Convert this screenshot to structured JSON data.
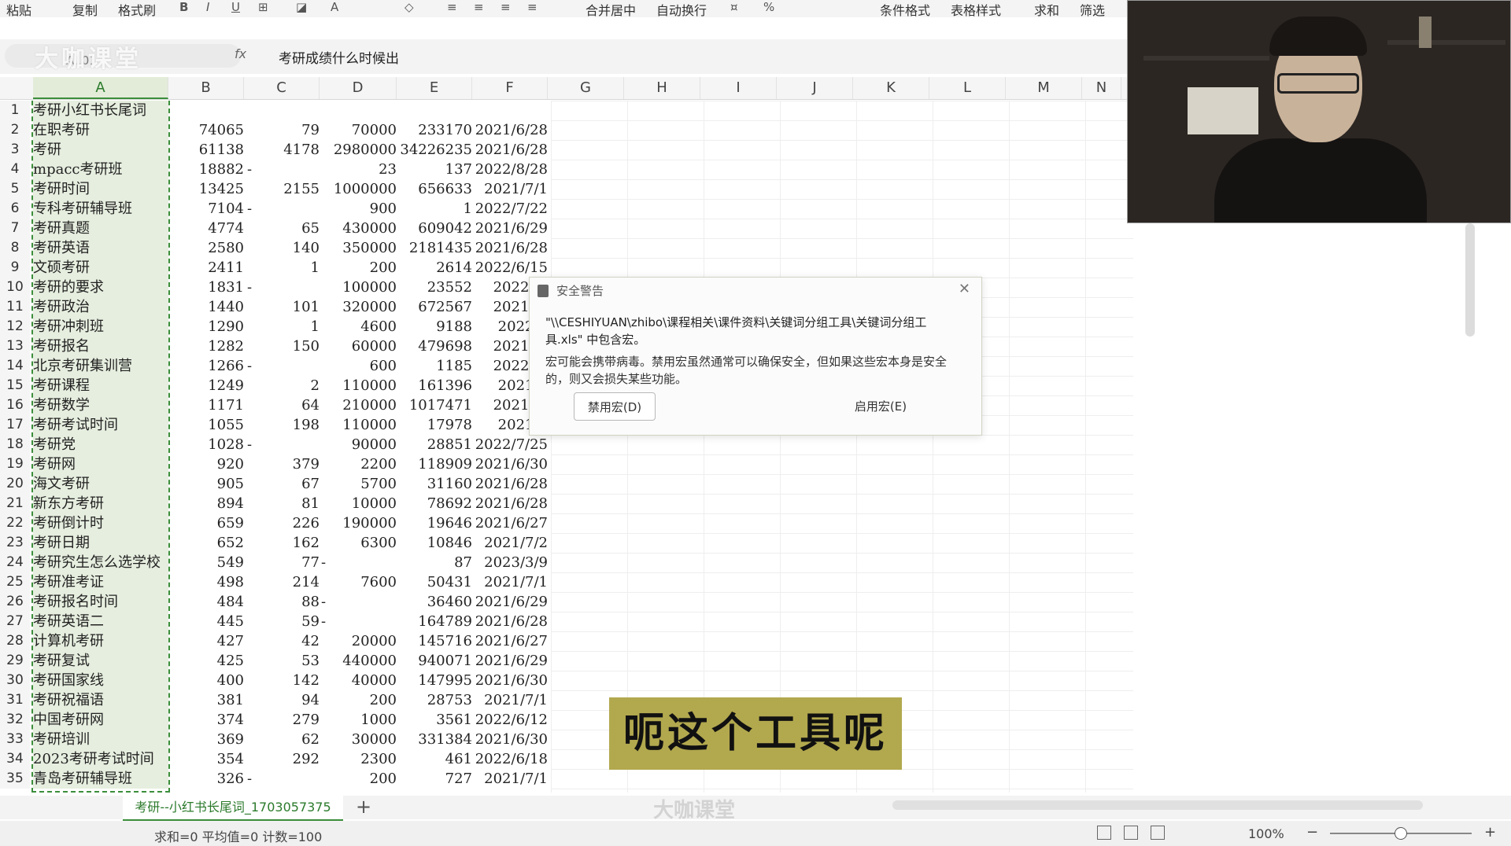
{
  "toolbar": {
    "items": [
      "粘贴",
      "复制",
      "格式刷",
      "合并居中",
      "自动换行",
      "条件格式",
      "表格样式",
      "求和",
      "筛选"
    ]
  },
  "formula_bar": {
    "cell_ref": "A101",
    "brand": "大咖课堂",
    "fx": "fx",
    "content": "考研成绩什么时候出"
  },
  "columns": [
    "A",
    "B",
    "C",
    "D",
    "E",
    "F",
    "G",
    "H",
    "I",
    "J",
    "K",
    "L",
    "M",
    "N"
  ],
  "rows": [
    {
      "n": "1",
      "a": "考研小红书长尾词",
      "b": "",
      "c": "",
      "d": "",
      "e": "",
      "f": ""
    },
    {
      "n": "2",
      "a": "在职考研",
      "b": "74065",
      "c": "79",
      "d": "70000",
      "e": "233170",
      "f": "2021/6/28"
    },
    {
      "n": "3",
      "a": "考研",
      "b": "61138",
      "c": "4178",
      "d": "2980000",
      "e": "34226235",
      "f": "2021/6/28"
    },
    {
      "n": "4",
      "a": "mpacc考研班",
      "b": "18882",
      "cdash": "-",
      "d": "23",
      "e": "137",
      "f": "2022/8/28"
    },
    {
      "n": "5",
      "a": "考研时间",
      "b": "13425",
      "c": "2155",
      "d": "1000000",
      "e": "656633",
      "f": "2021/7/1"
    },
    {
      "n": "6",
      "a": "专科考研辅导班",
      "b": "7104",
      "cdash": "-",
      "d": "900",
      "e": "1",
      "f": "2022/7/22"
    },
    {
      "n": "7",
      "a": "考研真题",
      "b": "4774",
      "c": "65",
      "d": "430000",
      "e": "609042",
      "f": "2021/6/29"
    },
    {
      "n": "8",
      "a": "考研英语",
      "b": "2580",
      "c": "140",
      "d": "350000",
      "e": "2181435",
      "f": "2021/6/28"
    },
    {
      "n": "9",
      "a": "文硕考研",
      "b": "2411",
      "c": "1",
      "d": "200",
      "e": "2614",
      "f": "2022/6/15"
    },
    {
      "n": "10",
      "a": "考研的要求",
      "b": "1831",
      "cdash": "-",
      "d": "100000",
      "e": "23552",
      "f": "2022/6/"
    },
    {
      "n": "11",
      "a": "考研政治",
      "b": "1440",
      "c": "101",
      "d": "320000",
      "e": "672567",
      "f": "2021/6/"
    },
    {
      "n": "12",
      "a": "考研冲刺班",
      "b": "1290",
      "c": "1",
      "d": "4600",
      "e": "9188",
      "f": "2022/7"
    },
    {
      "n": "13",
      "a": "考研报名",
      "b": "1282",
      "c": "150",
      "d": "60000",
      "e": "479698",
      "f": "2021/6/"
    },
    {
      "n": "14",
      "a": "北京考研集训营",
      "b": "1266",
      "cdash": "-",
      "d": "600",
      "e": "1185",
      "f": "2022/6/"
    },
    {
      "n": "15",
      "a": "考研课程",
      "b": "1249",
      "c": "2",
      "d": "110000",
      "e": "161396",
      "f": "2021/7"
    },
    {
      "n": "16",
      "a": "考研数学",
      "b": "1171",
      "c": "64",
      "d": "210000",
      "e": "1017471",
      "f": "2021/6/"
    },
    {
      "n": "17",
      "a": "考研考试时间",
      "b": "1055",
      "c": "198",
      "d": "110000",
      "e": "17978",
      "f": "2021/7"
    },
    {
      "n": "18",
      "a": "考研党",
      "b": "1028",
      "cdash": "-",
      "d": "90000",
      "e": "28851",
      "f": "2022/7/25"
    },
    {
      "n": "19",
      "a": "考研网",
      "b": "920",
      "c": "379",
      "d": "2200",
      "e": "118909",
      "f": "2021/6/30"
    },
    {
      "n": "20",
      "a": "海文考研",
      "b": "905",
      "c": "67",
      "d": "5700",
      "e": "31160",
      "f": "2021/6/28"
    },
    {
      "n": "21",
      "a": "新东方考研",
      "b": "894",
      "c": "81",
      "d": "10000",
      "e": "78692",
      "f": "2021/6/28"
    },
    {
      "n": "22",
      "a": "考研倒计时",
      "b": "659",
      "c": "226",
      "d": "190000",
      "e": "19646",
      "f": "2021/6/27"
    },
    {
      "n": "23",
      "a": "考研日期",
      "b": "652",
      "c": "162",
      "d": "6300",
      "e": "10846",
      "f": "2021/7/2"
    },
    {
      "n": "24",
      "a": "考研究生怎么选学校",
      "b": "549",
      "c": "77",
      "ddash": "-",
      "e": "87",
      "f": "2023/3/9"
    },
    {
      "n": "25",
      "a": "考研准考证",
      "b": "498",
      "c": "214",
      "d": "7600",
      "e": "50431",
      "f": "2021/7/1"
    },
    {
      "n": "26",
      "a": "考研报名时间",
      "b": "484",
      "c": "88",
      "ddash": "-",
      "e": "36460",
      "f": "2021/6/29"
    },
    {
      "n": "27",
      "a": "考研英语二",
      "b": "445",
      "c": "59",
      "ddash": "-",
      "e": "164789",
      "f": "2021/6/28"
    },
    {
      "n": "28",
      "a": "计算机考研",
      "b": "427",
      "c": "42",
      "d": "20000",
      "e": "145716",
      "f": "2021/6/27"
    },
    {
      "n": "29",
      "a": "考研复试",
      "b": "425",
      "c": "53",
      "d": "440000",
      "e": "940071",
      "f": "2021/6/29"
    },
    {
      "n": "30",
      "a": "考研国家线",
      "b": "400",
      "c": "142",
      "d": "40000",
      "e": "147995",
      "f": "2021/6/30"
    },
    {
      "n": "31",
      "a": "考研祝福语",
      "b": "381",
      "c": "94",
      "d": "200",
      "e": "28753",
      "f": "2021/7/1"
    },
    {
      "n": "32",
      "a": "中国考研网",
      "b": "374",
      "c": "279",
      "d": "1000",
      "e": "3561",
      "f": "2022/6/12"
    },
    {
      "n": "33",
      "a": "考研培训",
      "b": "369",
      "c": "62",
      "d": "30000",
      "e": "331384",
      "f": "2021/6/30"
    },
    {
      "n": "34",
      "a": "2023考研考试时间",
      "b": "354",
      "c": "292",
      "d": "2300",
      "e": "461",
      "f": "2022/6/18"
    },
    {
      "n": "35",
      "a": "青岛考研辅导班",
      "b": "326",
      "cdash": "-",
      "d": "200",
      "e": "727",
      "f": "2021/7/1"
    }
  ],
  "dialog": {
    "title": "安全警告",
    "path_line": "\"\\\\CESHIYUAN\\zhibo\\课程相关\\课件资料\\关键词分组工具\\关键词分组工具.xls\" 中包含宏。",
    "message": "宏可能会携带病毒。禁用宏虽然通常可以确保安全，但如果这些宏本身是安全的，则又会损失某些功能。",
    "disable_label": "禁用宏(D)",
    "enable_label": "启用宏(E)"
  },
  "subtitle": "呃这个工具呢",
  "sheet_tab": "考研--小红书长尾词_1703057375",
  "add_sheet": "+",
  "watermark": "大咖课堂",
  "status": {
    "summary": "求和=0  平均值=0  计数=100",
    "zoom": "100%"
  }
}
